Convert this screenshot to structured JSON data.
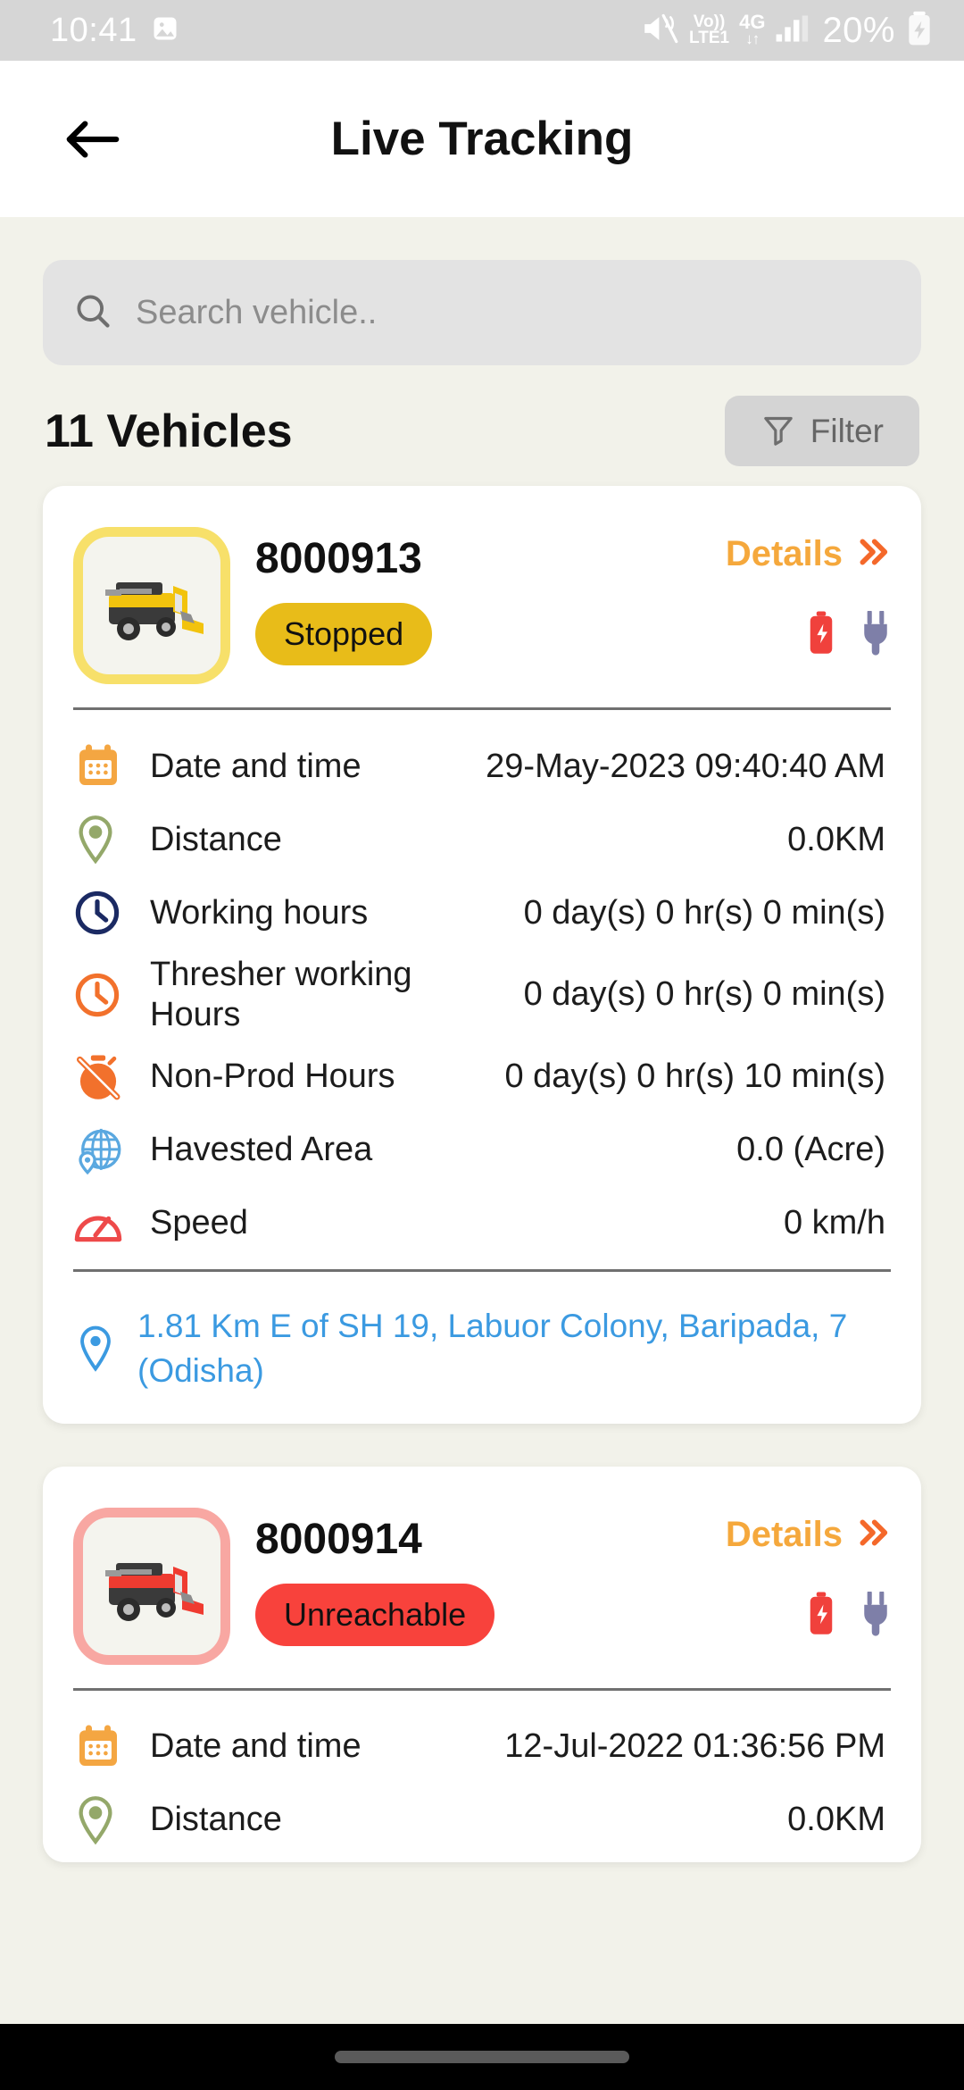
{
  "status_bar": {
    "time": "10:41",
    "battery_percent": "20%",
    "volte_line1": "Vo))",
    "volte_line2": "LTE1",
    "network": "4G",
    "network_arrows": "↓↑",
    "icons": [
      "gallery-icon",
      "mute-icon",
      "volte-icon",
      "4g-icon",
      "signal-icon",
      "battery-charging-icon"
    ]
  },
  "app_bar": {
    "title": "Live Tracking",
    "back_icon": "arrow-left-icon"
  },
  "search": {
    "placeholder": "Search vehicle..",
    "value": "",
    "icon": "search-icon"
  },
  "list_header": {
    "count_label": "11 Vehicles",
    "filter_label": "Filter",
    "filter_icon": "funnel-icon"
  },
  "colors": {
    "page_bg": "#f2f2ea",
    "card_bg": "#ffffff",
    "accent_orange": "#f5a83c",
    "stopped_yellow": "#e8bc19",
    "unreachable_red": "#f8423c",
    "address_blue": "#3b9ae1",
    "calendar_orange": "#f4a642",
    "pin_green": "#94a86a",
    "clock_navy": "#1b2a63",
    "clock_orange": "#f2712c",
    "globe_blue": "#5aa8e0",
    "speed_red": "#ee4a4a",
    "battery_red": "#f0413c",
    "plug_purple": "#7e7fa8"
  },
  "vehicles": [
    {
      "id": "8000913",
      "status": "Stopped",
      "status_type": "stopped",
      "thumb_color": "yellow",
      "details_label": "Details",
      "details_chevron": "»",
      "rows": [
        {
          "icon": "calendar-icon",
          "label": "Date and time",
          "value": "29-May-2023 09:40:40 AM"
        },
        {
          "icon": "map-pin-icon",
          "label": "Distance",
          "value": "0.0KM"
        },
        {
          "icon": "clock-navy-icon",
          "label": "Working hours",
          "value": "0 day(s) 0 hr(s) 0 min(s)"
        },
        {
          "icon": "clock-orange-icon",
          "label": "Thresher working Hours",
          "value": "0 day(s) 0 hr(s) 0 min(s)"
        },
        {
          "icon": "stopwatch-off-icon",
          "label": "Non-Prod Hours",
          "value": "0 day(s) 0 hr(s) 10 min(s)"
        },
        {
          "icon": "globe-icon",
          "label": "Havested Area",
          "value": "0.0 (Acre)"
        },
        {
          "icon": "speedometer-icon",
          "label": "Speed",
          "value": "0 km/h"
        }
      ],
      "address": "1.81 Km  E  of SH 19, Labuor Colony, Baripada,  7 (Odisha)"
    },
    {
      "id": "8000914",
      "status": "Unreachable",
      "status_type": "unreachable",
      "thumb_color": "red",
      "details_label": "Details",
      "details_chevron": "»",
      "rows": [
        {
          "icon": "calendar-icon",
          "label": "Date and time",
          "value": "12-Jul-2022 01:36:56 PM"
        },
        {
          "icon": "map-pin-icon",
          "label": "Distance",
          "value": "0.0KM"
        }
      ],
      "address": ""
    }
  ]
}
